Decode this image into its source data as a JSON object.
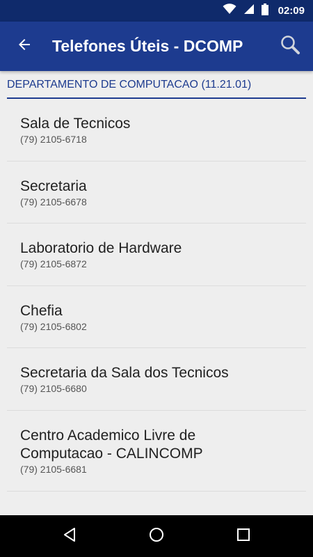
{
  "status_bar": {
    "time": "02:09",
    "icons": [
      "wifi-icon",
      "signal-icon",
      "battery-icon"
    ]
  },
  "app_bar": {
    "title": "Telefones Úteis - DCOMP",
    "back_icon": "arrow-back-icon",
    "search_icon": "search-icon",
    "color": "#1d3b8f"
  },
  "section": {
    "title": "DEPARTAMENTO DE COMPUTACAO (11.21.01)"
  },
  "contacts": [
    {
      "name": "Sala de Tecnicos",
      "phone": "(79) 2105-6718"
    },
    {
      "name": "Secretaria",
      "phone": "(79) 2105-6678"
    },
    {
      "name": "Laboratorio de Hardware",
      "phone": "(79) 2105-6872"
    },
    {
      "name": "Chefia",
      "phone": "(79) 2105-6802"
    },
    {
      "name": "Secretaria da Sala dos Tecnicos",
      "phone": "(79) 2105-6680"
    },
    {
      "name": "Centro Academico Livre de Computacao - CALINCOMP",
      "phone": "(79) 2105-6681"
    }
  ],
  "nav_bar": {
    "icons": [
      "nav-back-icon",
      "nav-home-icon",
      "nav-recents-icon"
    ]
  }
}
